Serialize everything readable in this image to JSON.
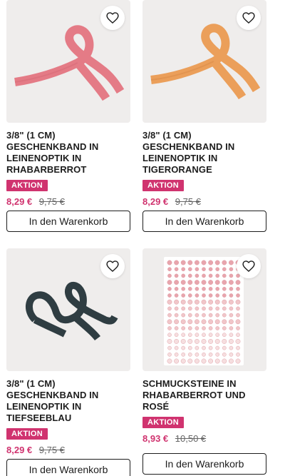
{
  "products": [
    {
      "title": "3/8\" (1 CM)\nGESCHENKBAND IN\nLEINENOPTIK IN\nRHABARBERROT",
      "badge": "AKTION",
      "sale_price": "8,29 €",
      "old_price": "9,75 €",
      "cart_label": "In den Warenkorb",
      "ribbon_color": "#e47b86"
    },
    {
      "title": "3/8\" (1 CM)\nGESCHENKBAND IN\nLEINENOPTIK IN\nTIGERORANGE",
      "badge": "AKTION",
      "sale_price": "8,29 €",
      "old_price": "9,75 €",
      "cart_label": "In den Warenkorb",
      "ribbon_color": "#eb9f5a"
    },
    {
      "title": "3/8\" (1 CM)\nGESCHENKBAND IN\nLEINENOPTIK IN\nTIEFSEEBLAU",
      "badge": "AKTION",
      "sale_price": "8,29 €",
      "old_price": "9,75 €",
      "cart_label": "In den Warenkorb",
      "ribbon_color": "#2f3d42"
    },
    {
      "title": "SCHMUCKSTEINE IN\nRHABARBERROT UND ROSÉ",
      "badge": "AKTION",
      "sale_price": "8,93 €",
      "old_price": "10,50 €",
      "cart_label": "In den Warenkorb",
      "gem_colors": [
        "#e8a5ad",
        "#f1c6c9",
        "#f6dedf"
      ]
    }
  ],
  "colors": {
    "accent": "#d0336f",
    "image_bg": "#efedec"
  },
  "icons": {
    "favorite": "heart-outline-icon"
  }
}
